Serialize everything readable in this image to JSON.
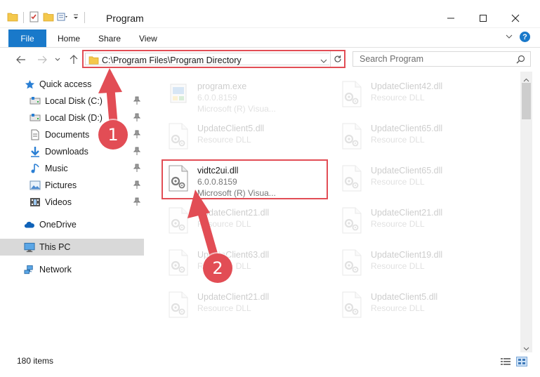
{
  "window": {
    "title": "Program"
  },
  "ribbon": {
    "tabs": [
      "File",
      "Home",
      "Share",
      "View"
    ],
    "help_label": "?"
  },
  "navigation": {
    "address": "C:\\Program Files\\Program Directory",
    "search_placeholder": "Search Program"
  },
  "sidebar": {
    "items": [
      {
        "label": "Quick access",
        "icon": "star-icon",
        "level": 0,
        "pinned": false,
        "selected": false
      },
      {
        "label": "Local Disk (C:)",
        "icon": "drive-icon",
        "level": 1,
        "pinned": true,
        "selected": false
      },
      {
        "label": "Local Disk (D:)",
        "icon": "drive-icon",
        "level": 1,
        "pinned": true,
        "selected": false
      },
      {
        "label": "Documents",
        "icon": "documents-icon",
        "level": 1,
        "pinned": true,
        "selected": false
      },
      {
        "label": "Downloads",
        "icon": "downloads-icon",
        "level": 1,
        "pinned": true,
        "selected": false
      },
      {
        "label": "Music",
        "icon": "music-icon",
        "level": 1,
        "pinned": true,
        "selected": false
      },
      {
        "label": "Pictures",
        "icon": "pictures-icon",
        "level": 1,
        "pinned": true,
        "selected": false
      },
      {
        "label": "Videos",
        "icon": "videos-icon",
        "level": 1,
        "pinned": true,
        "selected": false
      },
      {
        "label": "OneDrive",
        "icon": "cloud-icon",
        "level": 0,
        "pinned": false,
        "selected": false
      },
      {
        "label": "This PC",
        "icon": "computer-icon",
        "level": 0,
        "pinned": false,
        "selected": true
      },
      {
        "label": "Network",
        "icon": "network-icon",
        "level": 0,
        "pinned": false,
        "selected": false
      }
    ]
  },
  "files": [
    {
      "name": "program.exe",
      "version": "6.0.0.8159",
      "description": "Microsoft (R) Visua...",
      "faded": true,
      "type": "exe"
    },
    {
      "name": "UpdateClient42.dll",
      "version": "Resource DLL",
      "description": "",
      "faded": true,
      "type": "dll"
    },
    {
      "name": "UpdateClient5.dll",
      "version": "Resource DLL",
      "description": "",
      "faded": true,
      "type": "dll"
    },
    {
      "name": "UpdateClient65.dll",
      "version": "Resource DLL",
      "description": "",
      "faded": true,
      "type": "dll"
    },
    {
      "name": "vidtc2ui.dll",
      "version": "6.0.0.8159",
      "description": "Microsoft (R) Visua...",
      "faded": false,
      "type": "dll"
    },
    {
      "name": "UpdateClient65.dll",
      "version": "Resource DLL",
      "description": "",
      "faded": true,
      "type": "dll"
    },
    {
      "name": "UpdateClient21.dll",
      "version": "Resource DLL",
      "description": "",
      "faded": true,
      "type": "dll"
    },
    {
      "name": "UpdateClient21.dll",
      "version": "Resource DLL",
      "description": "",
      "faded": true,
      "type": "dll"
    },
    {
      "name": "UpdateClient63.dll",
      "version": "Resource DLL",
      "description": "",
      "faded": true,
      "type": "dll"
    },
    {
      "name": "UpdateClient19.dll",
      "version": "Resource DLL",
      "description": "",
      "faded": true,
      "type": "dll"
    },
    {
      "name": "UpdateClient21.dll",
      "version": "Resource DLL",
      "description": "",
      "faded": true,
      "type": "dll"
    },
    {
      "name": "UpdateClient5.dll",
      "version": "Resource DLL",
      "description": "",
      "faded": true,
      "type": "dll"
    }
  ],
  "status": {
    "item_count": "180 items"
  },
  "annotations": {
    "step1": "1",
    "step2": "2"
  },
  "colors": {
    "accent": "#1979ca",
    "highlight": "#e24d55",
    "selected_bg": "#d9d9d9"
  }
}
